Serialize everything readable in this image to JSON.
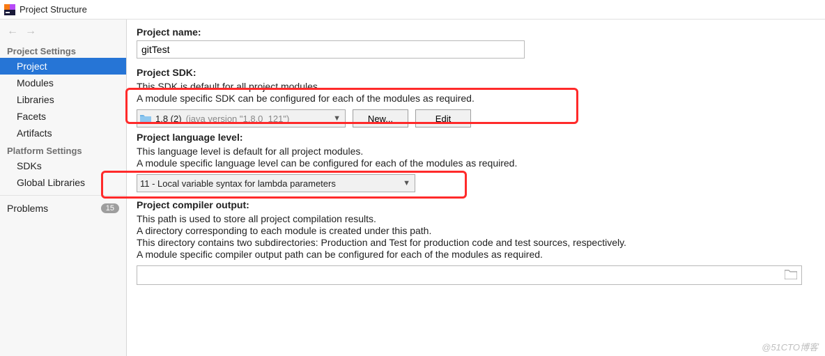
{
  "window": {
    "title": "Project Structure"
  },
  "nav": {
    "back": "←",
    "fwd": "→"
  },
  "sidebar": {
    "heading_project_settings": "Project Settings",
    "items": [
      {
        "label": "Project"
      },
      {
        "label": "Modules"
      },
      {
        "label": "Libraries"
      },
      {
        "label": "Facets"
      },
      {
        "label": "Artifacts"
      }
    ],
    "heading_platform_settings": "Platform Settings",
    "platform_items": [
      {
        "label": "SDKs"
      },
      {
        "label": "Global Libraries"
      }
    ],
    "problems": {
      "label": "Problems",
      "count": "15"
    }
  },
  "main": {
    "project_name": {
      "label": "Project name:",
      "value": "gitTest"
    },
    "sdk": {
      "label": "Project SDK:",
      "desc1": "This SDK is default for all project modules.",
      "desc2": "A module specific SDK can be configured for each of the modules as required.",
      "selected_name": "1.8 (2)",
      "selected_detail": "(java version \"1.8.0_121\")",
      "new_accel": "N",
      "new_rest": "ew...",
      "edit_accel": "E",
      "edit_rest": "dit"
    },
    "lang": {
      "label": "Project language level:",
      "desc1": "This language level is default for all project modules.",
      "desc2": "A module specific language level can be configured for each of the modules as required.",
      "selected": "11 - Local variable syntax for lambda parameters"
    },
    "output": {
      "label": "Project compiler output:",
      "desc1": "This path is used to store all project compilation results.",
      "desc2": "A directory corresponding to each module is created under this path.",
      "desc3": "This directory contains two subdirectories: Production and Test for production code and test sources, respectively.",
      "desc4": "A module specific compiler output path can be configured for each of the modules as required.",
      "value": ""
    }
  },
  "watermark": "@51CTO博客"
}
